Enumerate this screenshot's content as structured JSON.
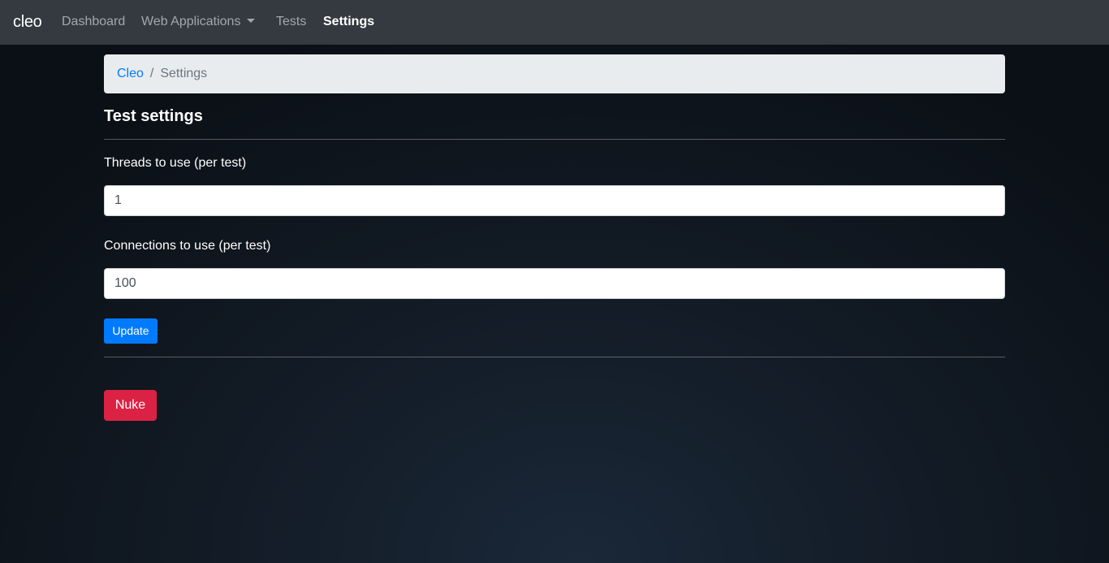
{
  "navbar": {
    "brand": "cleo",
    "links": [
      {
        "label": "Dashboard"
      },
      {
        "label": "Web Applications"
      },
      {
        "label": "Tests"
      },
      {
        "label": "Settings"
      }
    ]
  },
  "breadcrumb": {
    "root": "Cleo",
    "separator": "/",
    "current": "Settings"
  },
  "settings": {
    "title": "Test settings",
    "threads": {
      "label": "Threads to use (per test)",
      "value": "1"
    },
    "connections": {
      "label": "Connections to use (per test)",
      "value": "100"
    },
    "update_label": "Update",
    "nuke_label": "Nuke"
  },
  "colors": {
    "navbar_bg": "#343a40",
    "primary": "#007bff",
    "danger": "#dc2244",
    "breadcrumb_bg": "#e9ecef"
  }
}
